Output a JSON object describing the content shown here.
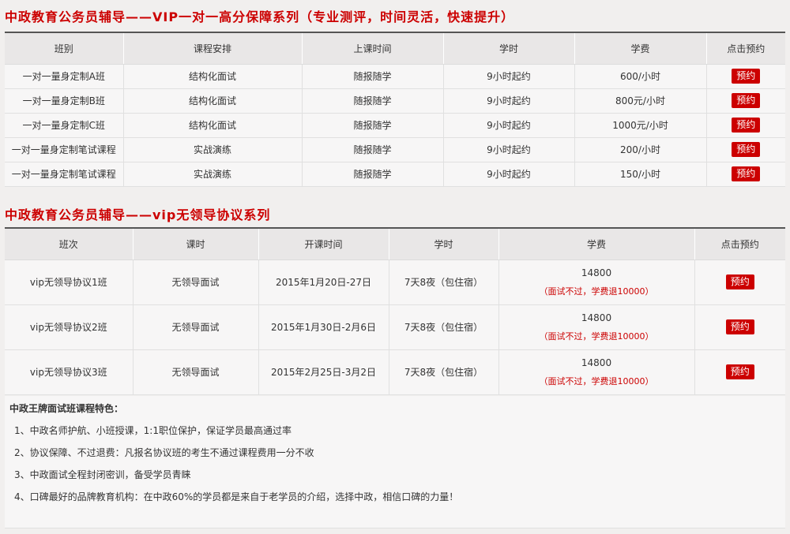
{
  "section1": {
    "title": "中政教育公务员辅导——VIP一对一高分保障系列（专业测评，时间灵活，快速提升）",
    "headers": [
      "班别",
      "课程安排",
      "上课时间",
      "学时",
      "学费",
      "点击预约"
    ],
    "rows": [
      {
        "name": "一对一量身定制A班",
        "course": "结构化面试",
        "time": "随报随学",
        "hours": "9小时起约",
        "fee": "600/小时",
        "button": "预约"
      },
      {
        "name": "一对一量身定制B班",
        "course": "结构化面试",
        "time": "随报随学",
        "hours": "9小时起约",
        "fee": "800元/小时",
        "button": "预约"
      },
      {
        "name": "一对一量身定制C班",
        "course": "结构化面试",
        "time": "随报随学",
        "hours": "9小时起约",
        "fee": "1000元/小时",
        "button": "预约"
      },
      {
        "name": "一对一量身定制笔试课程",
        "course": "实战演练",
        "time": "随报随学",
        "hours": "9小时起约",
        "fee": "200/小时",
        "button": "预约"
      },
      {
        "name": "一对一量身定制笔试课程",
        "course": "实战演练",
        "time": "随报随学",
        "hours": "9小时起约",
        "fee": "150/小时",
        "button": "预约"
      }
    ]
  },
  "section2": {
    "title": "中政教育公务员辅导——vip无领导协议系列",
    "headers": [
      "班次",
      "课时",
      "开课时间",
      "学时",
      "学费",
      "点击预约"
    ],
    "rows": [
      {
        "name": "vip无领导协议1班",
        "course": "无领导面试",
        "start": "2015年1月20日-27日",
        "hours": "7天8夜（包住宿）",
        "fee": "14800",
        "note": "（面试不过，学费退10000）",
        "button": "预约"
      },
      {
        "name": "vip无领导协议2班",
        "course": "无领导面试",
        "start": "2015年1月30日-2月6日",
        "hours": "7天8夜（包住宿）",
        "fee": "14800",
        "note": "（面试不过，学费退10000）",
        "button": "预约"
      },
      {
        "name": "vip无领导协议3班",
        "course": "无领导面试",
        "start": "2015年2月25日-3月2日",
        "hours": "7天8夜（包住宿）",
        "fee": "14800",
        "note": "（面试不过，学费退10000）",
        "button": "预约"
      }
    ]
  },
  "features": {
    "title": "中政王牌面试班课程特色：",
    "items": [
      "1、中政名师护航、小班授课，1:1职位保护，保证学员最高通过率",
      "2、协议保障、不过退费：凡报名协议班的考生不通过课程费用一分不收",
      "3、中政面试全程封闭密训，备受学员青睐",
      "4、口碑最好的品牌教育机构：在中政60%的学员都是来自于老学员的介绍，选择中政，相信口碑的力量！"
    ]
  }
}
